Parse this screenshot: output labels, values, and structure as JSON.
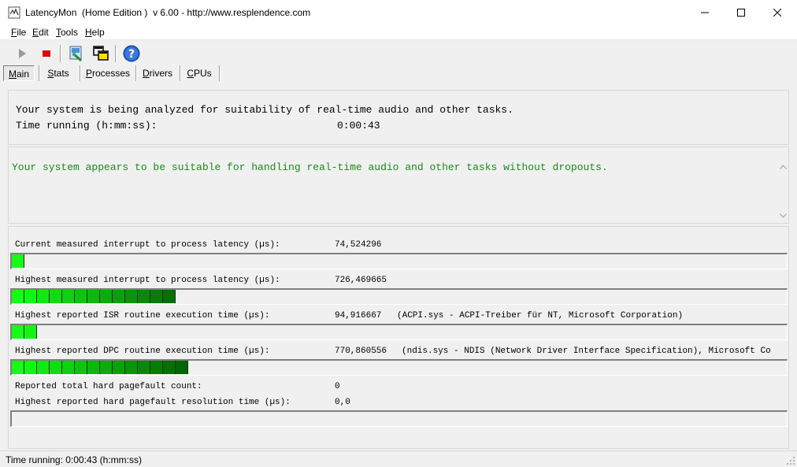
{
  "window": {
    "title": "LatencyMon  (Home Edition )  v 6.00 - http://www.resplendence.com"
  },
  "menu": [
    "File",
    "Edit",
    "Tools",
    "Help"
  ],
  "toolbar": {
    "icons": [
      "play-icon",
      "stop-icon",
      "report-icon",
      "windows-icon",
      "help-icon"
    ]
  },
  "tabs": [
    "Main",
    "Stats",
    "Processes",
    "Drivers",
    "CPUs"
  ],
  "status_panel": {
    "line1": "Your system is being analyzed for suitability of real-time audio and other tasks.",
    "time_label": "Time running (h:mm:ss):",
    "time_value": "0:00:43"
  },
  "result_panel": {
    "message": "Your system appears to be suitable for handling real-time audio and other tasks without dropouts.",
    "color": "#1a8a1a"
  },
  "metrics": [
    {
      "label": "Current measured interrupt to process latency (µs):",
      "value": "74,524296",
      "desc": "",
      "bar_segments": 1,
      "has_bar": true
    },
    {
      "label": "Highest measured interrupt to process latency (µs):",
      "value": "726,469665",
      "desc": "",
      "bar_segments": 13,
      "has_bar": true
    },
    {
      "label": "Highest reported ISR routine execution time (µs):",
      "value": "94,916667",
      "desc": "(ACPI.sys - ACPI-Treiber für NT, Microsoft Corporation)",
      "bar_segments": 2,
      "has_bar": true
    },
    {
      "label": "Highest reported DPC routine execution time (µs):",
      "value": "770,860556",
      "desc": "(ndis.sys - NDIS (Network Driver Interface Specification), Microsoft Co",
      "bar_segments": 14,
      "has_bar": true
    },
    {
      "label": "Reported total hard pagefault count:",
      "value": "0",
      "desc": "",
      "bar_segments": 0,
      "has_bar": false
    },
    {
      "label": "Highest reported hard pagefault resolution time (µs):",
      "value": "0,0",
      "desc": "",
      "bar_segments": 0,
      "has_bar": true
    }
  ],
  "status_bar": {
    "text": "Time running: 0:00:43  (h:mm:ss)"
  }
}
